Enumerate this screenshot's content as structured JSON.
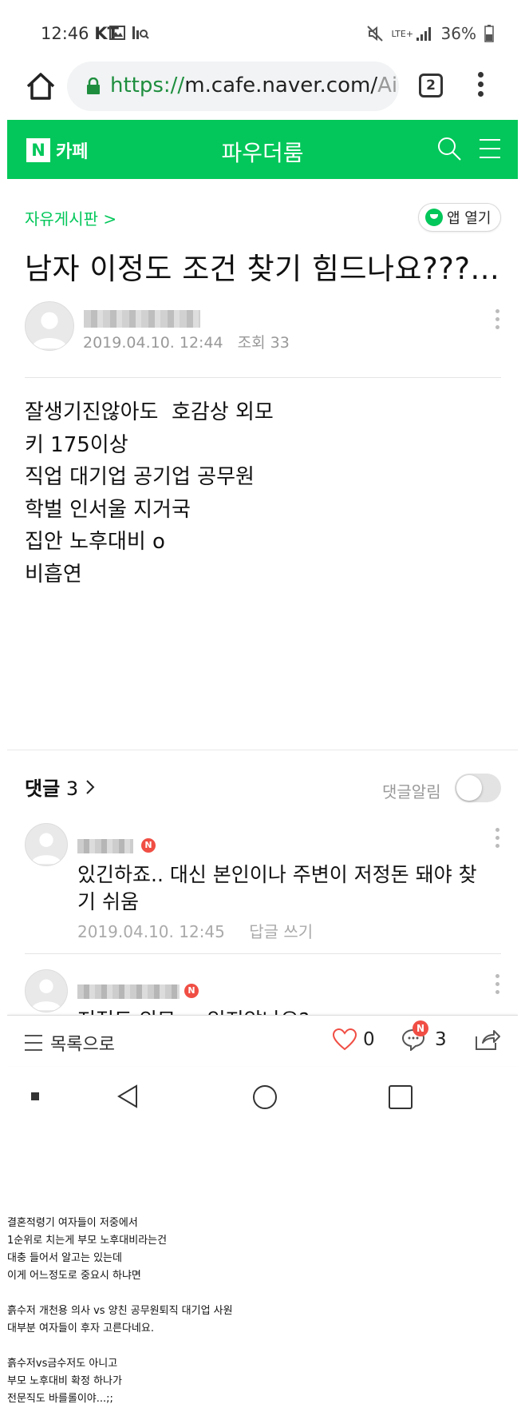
{
  "status_bar": {
    "time": "12:46",
    "carrier": "KT",
    "network": "LTE+",
    "battery": "36%"
  },
  "browser": {
    "url_scheme": "https://",
    "url_host": "m.cafe.naver.com/",
    "url_tail": "Ai",
    "tab_count": "2"
  },
  "cafe": {
    "logo_letter": "N",
    "logo_label": "카페",
    "title": "파우더룸",
    "brand_color": "#03c75a"
  },
  "post": {
    "board": "자유게시판 >",
    "app_open": "앱 열기",
    "title": "남자 이정도 조건 찾기 힘드나요???...",
    "date": "2019.04.10. 12:44",
    "views": "조회 33",
    "body": [
      "잘생기진않아도  호감상 외모",
      "키 175이상",
      "직업 대기업 공기업 공무원",
      "학벌 인서울 지거국",
      "집안 노후대비 o",
      "비흡연"
    ]
  },
  "comments": {
    "label": "댓글",
    "count": "3",
    "notify_label": "댓글알림",
    "items": [
      {
        "badge": "N",
        "text": "있긴하죠.. 대신 본인이나 주변이 저정돈 돼야 찾기 쉬움",
        "date": "2019.04.10. 12:45",
        "reply": "답글 쓰기"
      },
      {
        "badge": "N",
        "text": "저정도 외모 ... 있지않나요?"
      }
    ]
  },
  "action_bar": {
    "list_label": "목록으로",
    "likes": "0",
    "comments": "3",
    "comment_badge": "N"
  },
  "caption": [
    "결혼적령기 여자들이 저중에서",
    "1순위로 치는게 부모 노후대비라는건",
    "대충 들어서 알고는 있는데",
    "이게 어느정도로 중요시 하냐면",
    "",
    "흙수저 개천용 의사 vs 양친 공무원퇴직 대기업 사원",
    "대부분 여자들이 후자 고른다네요.",
    "",
    "흙수저vs금수저도 아니고",
    "부모 노후대비 확정 하나가",
    "전문직도 바를롤이야...;;"
  ]
}
